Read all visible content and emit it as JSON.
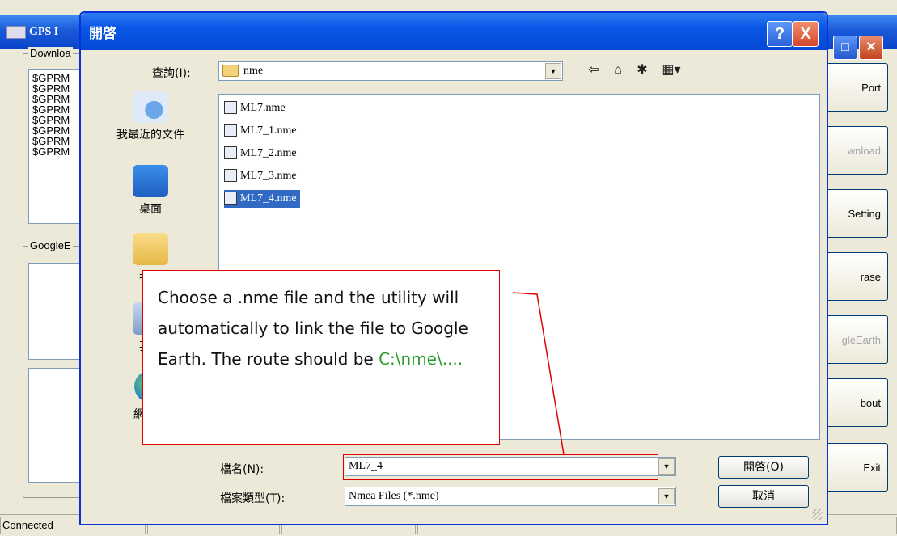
{
  "background_window": {
    "title": "GPS I",
    "download_group_label": "Downloa",
    "download_lines": [
      "$GPRM",
      "$GPRM",
      "$GPRM",
      "$GPRM",
      "$GPRM",
      "$GPRM",
      "$GPRM",
      "$GPRM"
    ],
    "google_group_label": "GoogleE",
    "buttons": [
      {
        "label": "Port",
        "disabled": false
      },
      {
        "label": "wnload",
        "disabled": true
      },
      {
        "label": "Setting",
        "disabled": false
      },
      {
        "label": "rase",
        "disabled": false
      },
      {
        "label": "gleEarth",
        "disabled": true
      },
      {
        "label": "bout",
        "disabled": false
      },
      {
        "label": "Exit",
        "disabled": false
      }
    ],
    "status_text": "Connected"
  },
  "dialog": {
    "title": "開啓",
    "help_button": "?",
    "close_button": "X",
    "look_in_label": "查詢(I):",
    "look_in_value": "nme",
    "places": [
      {
        "label": "我最近的文件",
        "icon": "recent-documents-icon"
      },
      {
        "label": "桌面",
        "icon": "desktop-icon"
      },
      {
        "label": "我的",
        "icon": "my-documents-icon"
      },
      {
        "label": "我的",
        "icon": "my-computer-icon"
      },
      {
        "label": "網路上",
        "icon": "network-icon"
      }
    ],
    "files": [
      "ML7.nme",
      "ML7_1.nme",
      "ML7_2.nme",
      "ML7_3.nme",
      "ML7_4.nme"
    ],
    "selected_file_index": 4,
    "filename_label": "檔名(N):",
    "filename_value": "ML7_4",
    "filetype_label": "檔案類型(T):",
    "filetype_value": "Nmea Files (*.nme)",
    "open_button": "開啓(O)",
    "cancel_button": "取消"
  },
  "callout": {
    "text_main": "Choose a .nme file and the utility will automatically to link the file to Google Earth. The route should be ",
    "text_path": "C:\\nme\\...."
  },
  "colors": {
    "titlebar_blue": "#0a56e6",
    "callout_border": "#e00000",
    "path_text": "#2a9d2a",
    "selection": "#316ac5"
  }
}
